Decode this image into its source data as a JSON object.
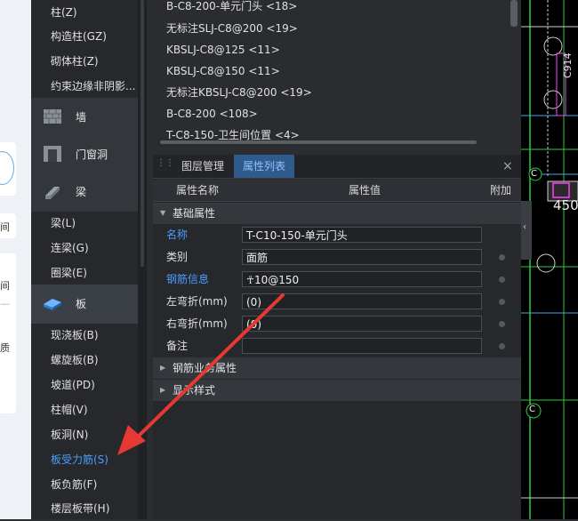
{
  "tree": {
    "items_top": [
      "柱(Z)",
      "构造柱(GZ)",
      "砌体柱(Z)",
      "约束边缘非阴影..."
    ],
    "categories": [
      {
        "icon": "wall-icon",
        "label": "墙"
      },
      {
        "icon": "door-window-icon",
        "label": "门窗洞"
      },
      {
        "icon": "beam-icon",
        "label": "梁"
      },
      {
        "icon": "slab-icon",
        "label": "板"
      }
    ],
    "beam_items": [
      "梁(L)",
      "连梁(G)",
      "圈梁(E)"
    ],
    "slab_items": [
      "现浇板(B)",
      "螺旋板(B)",
      "坡道(PD)",
      "柱帽(V)",
      "板洞(N)",
      "板受力筋(S)",
      "板负筋(F)",
      "楼层板带(H)"
    ]
  },
  "left_strip": {
    "chars": [
      "间",
      "间",
      "—",
      "质"
    ]
  },
  "top_list": {
    "items": [
      "B-C8-200-单元门头 <18>",
      "无标注SLJ-C8@200 <19>",
      "KBSLJ-C8@125 <11>",
      "KBSLJ-C8@150 <11>",
      "无标注KBSLJ-C8@200 <19>",
      "B-C8-200 <108>",
      "T-C8-150-卫生间位置 <4>"
    ]
  },
  "tabs": [
    "图层管理",
    "属性列表"
  ],
  "close_glyph": "×",
  "table": {
    "headers": [
      "属性名称",
      "属性值",
      "附加"
    ],
    "section_basic": "基础属性",
    "rows": [
      {
        "name": "名称",
        "value": "T-C10-150-单元门头",
        "blue": true,
        "dot": false
      },
      {
        "name": "类别",
        "value": "面筋",
        "blue": false,
        "dot": true
      },
      {
        "name": "钢筋信息",
        "value": "☥10@150",
        "blue": true,
        "dot": true
      },
      {
        "name": "左弯折(mm)",
        "value": "(0)",
        "blue": false,
        "dot": true
      },
      {
        "name": "右弯折(mm)",
        "value": "(0)",
        "blue": false,
        "dot": true
      },
      {
        "name": "备注",
        "value": "",
        "blue": false,
        "dot": true
      }
    ],
    "section_business": "钢筋业务属性",
    "section_display": "显示样式"
  },
  "cad": {
    "labels": [
      "C914",
      "450",
      "C",
      "C"
    ]
  },
  "colors": {
    "accent": "#4a9eff",
    "annotation_arrow": "#e53935"
  }
}
